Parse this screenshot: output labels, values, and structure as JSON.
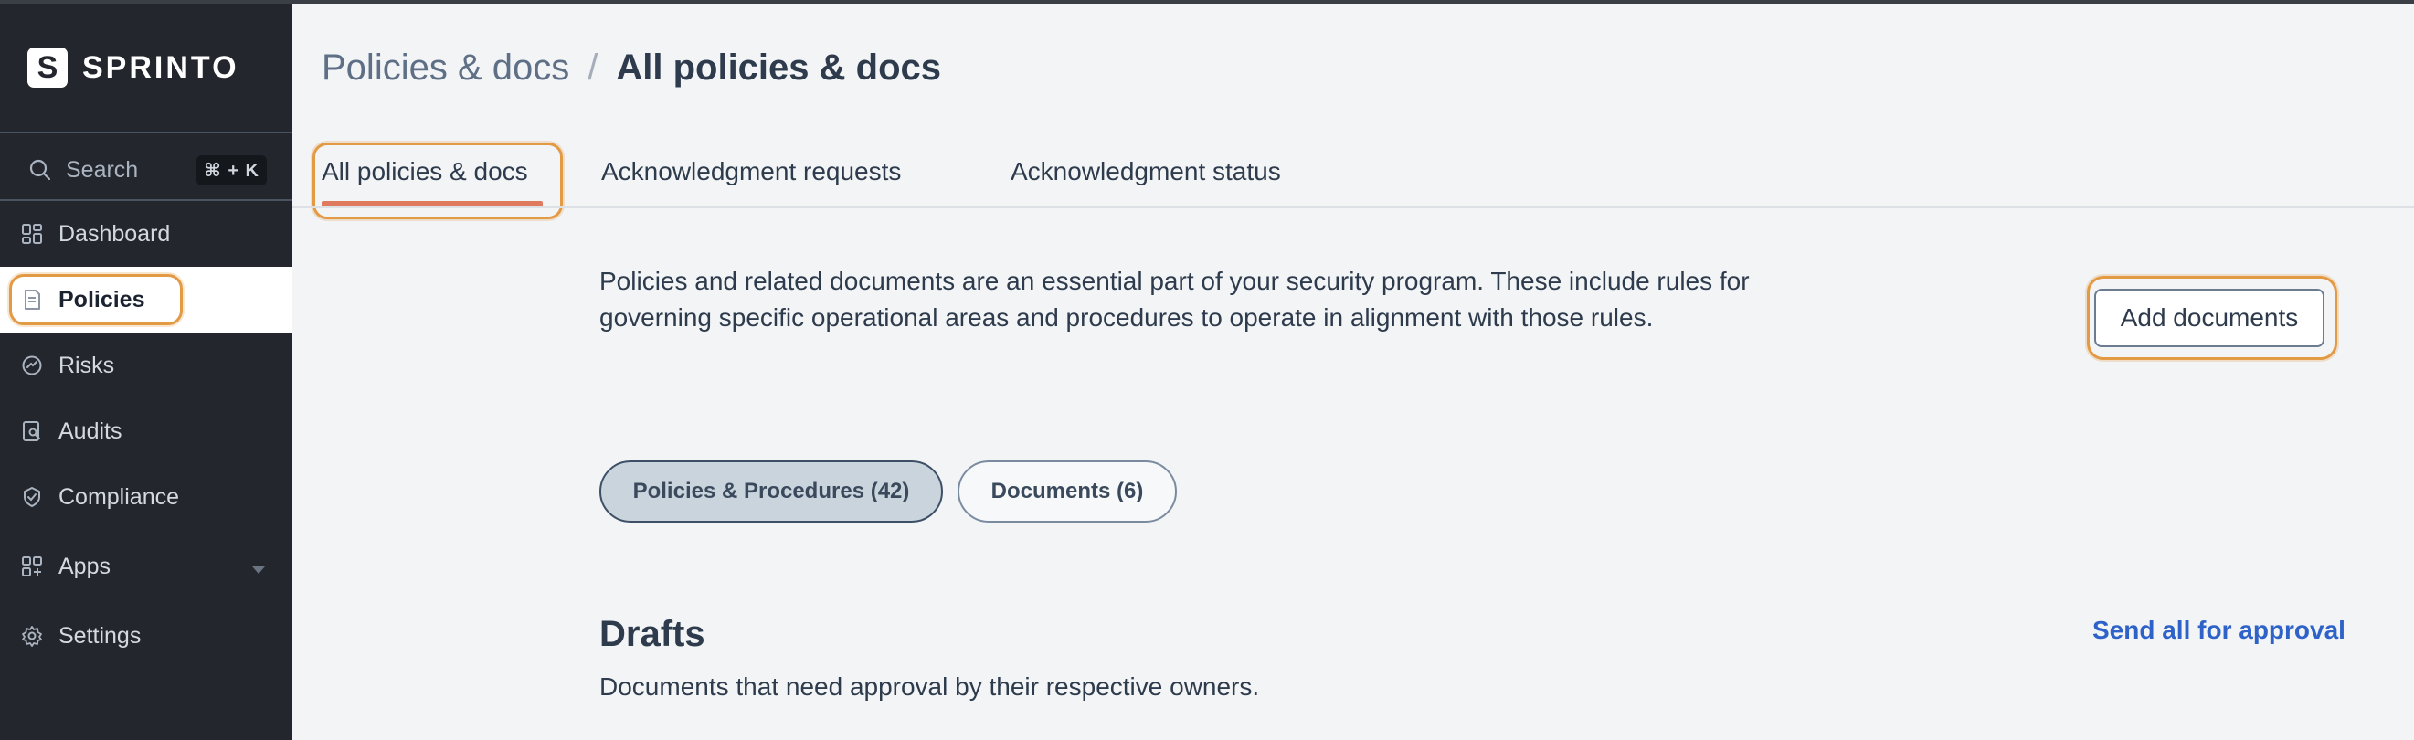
{
  "app": {
    "brand": "SPRINTO",
    "logo_letter": "S"
  },
  "sidebar": {
    "search": {
      "label": "Search",
      "shortcut": "⌘ + K"
    },
    "items": [
      {
        "label": "Dashboard",
        "icon": "dashboard-icon"
      },
      {
        "label": "Policies",
        "icon": "policy-document-icon",
        "active": true
      },
      {
        "label": "Risks",
        "icon": "risk-gauge-icon"
      },
      {
        "label": "Audits",
        "icon": "audit-search-icon"
      },
      {
        "label": "Compliance",
        "icon": "compliance-shield-icon"
      },
      {
        "label": "Apps",
        "icon": "apps-grid-icon",
        "has_submenu": true
      },
      {
        "label": "Settings",
        "icon": "gear-icon"
      }
    ]
  },
  "header": {
    "breadcrumb_parent": "Policies & docs",
    "breadcrumb_separator": "/",
    "title": "All policies & docs"
  },
  "tabs": [
    {
      "label": "All policies & docs",
      "active": true
    },
    {
      "label": "Acknowledgment requests"
    },
    {
      "label": "Acknowledgment status"
    }
  ],
  "content": {
    "intro": "Policies and related documents are an essential part of your security program. These include rules for governing specific operational areas and procedures to operate in alignment with those rules.",
    "add_button": "Add documents",
    "filters": [
      {
        "label": "Policies & Procedures (42)",
        "selected": true
      },
      {
        "label": "Documents (6)",
        "selected": false
      }
    ],
    "drafts": {
      "title": "Drafts",
      "subtitle": "Documents that need approval by their respective owners.",
      "action": "Send all for approval"
    }
  },
  "colors": {
    "sidebar_bg": "#23272d",
    "accent_underline": "#e07a5f",
    "highlight_ring": "#e39a45",
    "link": "#2e62c8"
  }
}
